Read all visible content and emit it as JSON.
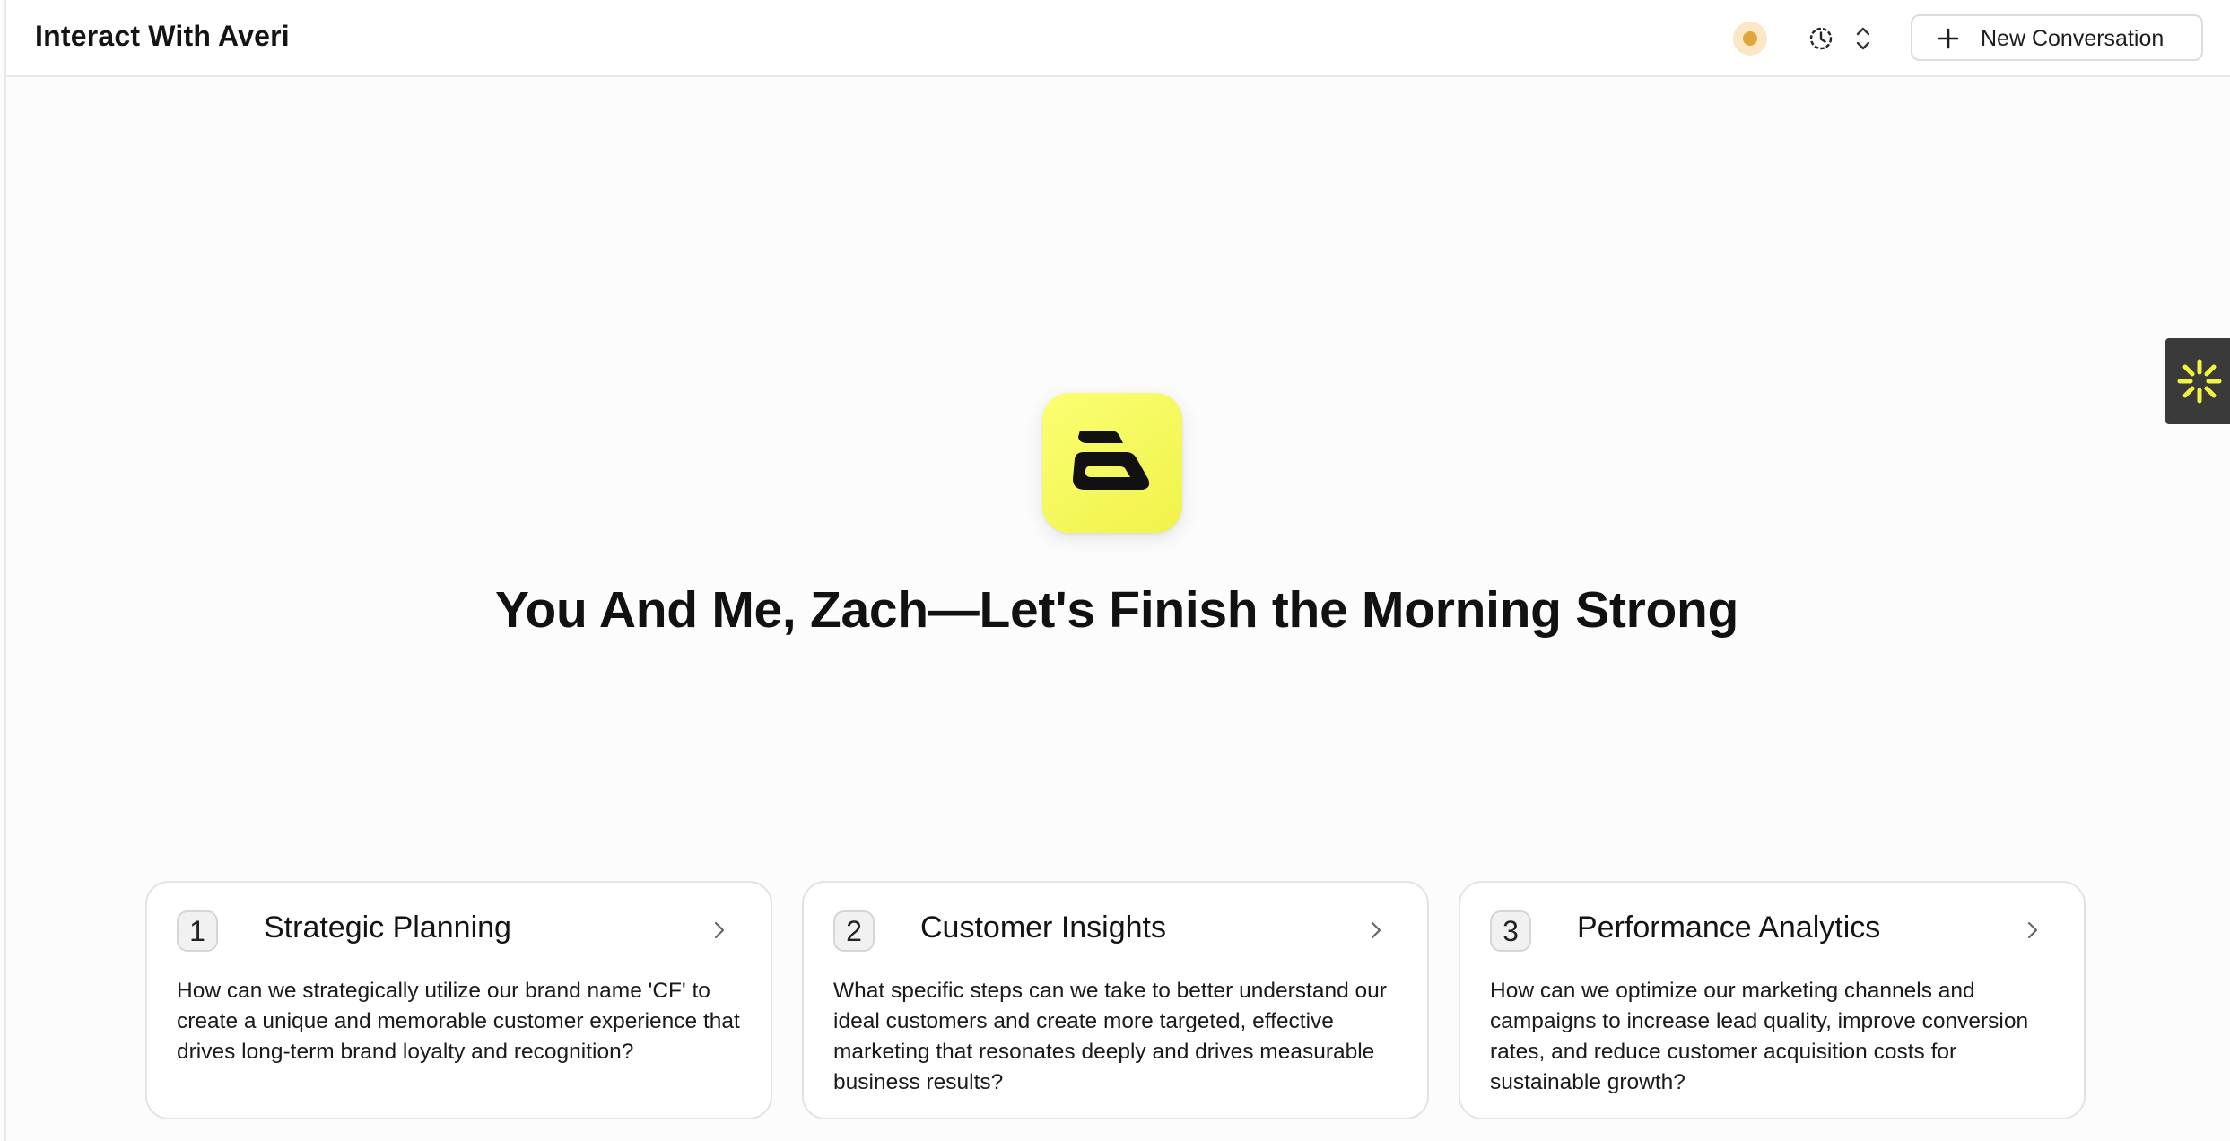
{
  "header": {
    "title": "Interact With Averi",
    "new_conversation_label": "New Conversation"
  },
  "icons": {
    "status": "status-dot-icon",
    "history": "history-clock-icon",
    "sort": "chevron-up-down-icon",
    "plus": "plus-icon",
    "side_tab": "sparkle-burst-icon",
    "logo": "averi-logo-icon",
    "card_arrow": "chevron-right-icon"
  },
  "colors": {
    "accent_yellow": "#f5f75c",
    "status_orange": "#e0a63c",
    "side_tab_bg": "#3a3a3a"
  },
  "hero": {
    "greeting": "You And Me, Zach—Let's Finish the Morning Strong"
  },
  "cards": [
    {
      "number": "1",
      "title": "Strategic Planning",
      "description": "How can we strategically utilize our brand name 'CF' to create a unique and memorable customer experience that drives long-term brand loyalty and recognition?"
    },
    {
      "number": "2",
      "title": "Customer Insights",
      "description": "What specific steps can we take to better understand our ideal customers and create more targeted, effective marketing that resonates deeply and drives measurable business results?"
    },
    {
      "number": "3",
      "title": "Performance Analytics",
      "description": "How can we optimize our marketing channels and campaigns to increase lead quality, improve conversion rates, and reduce customer acquisition costs for sustainable growth?"
    }
  ]
}
